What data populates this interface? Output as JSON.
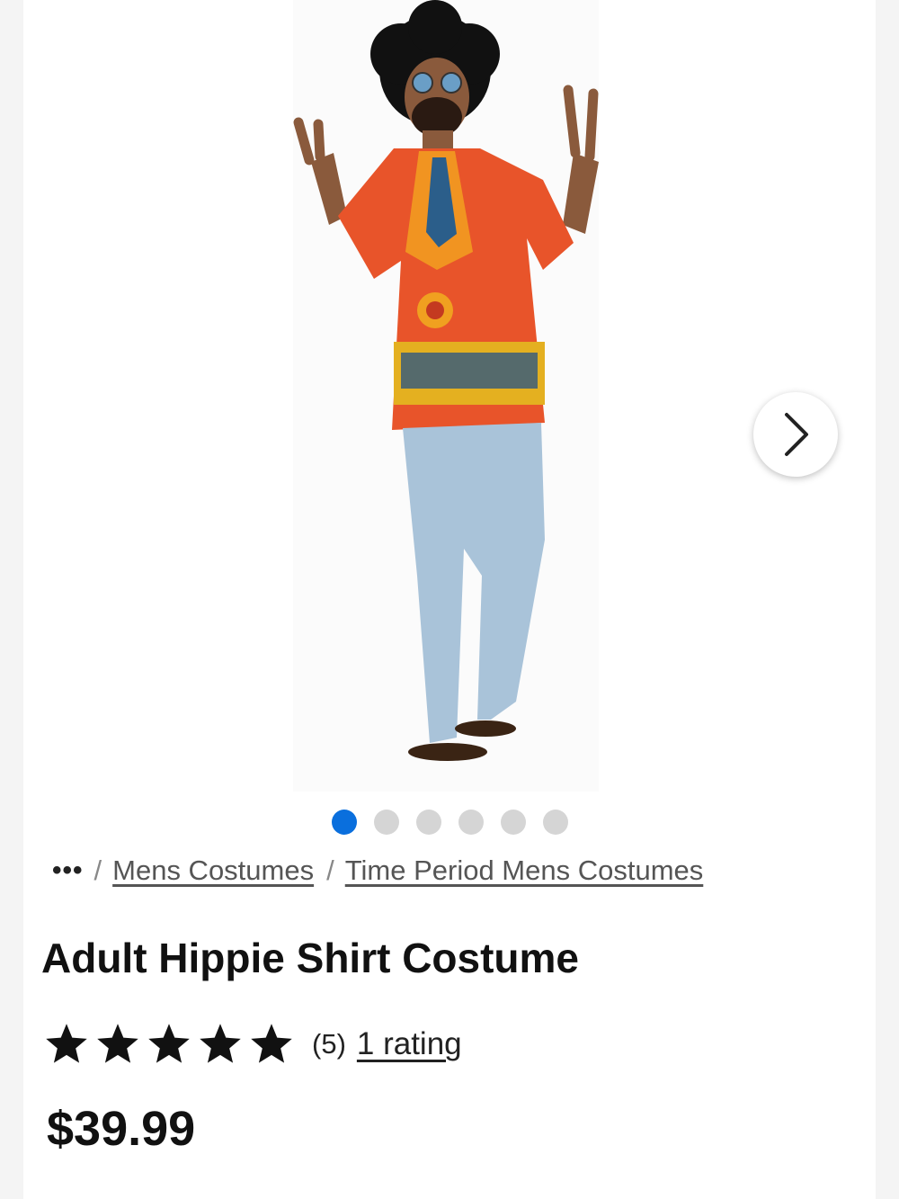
{
  "carousel": {
    "image_alt": "Man wearing orange patterned hippie shirt with afro wig, round sunglasses and jeans, making peace signs",
    "next_icon": "chevron-right-icon",
    "dots_total": 6,
    "active_dot": 1,
    "active_color": "#0a6fdd"
  },
  "breadcrumb": {
    "more": "•••",
    "separator": "/",
    "items": [
      "Mens Costumes",
      "Time Period Mens Costumes"
    ]
  },
  "product": {
    "title": "Adult Hippie Shirt Costume",
    "stars": 5,
    "rating_count": "(5)",
    "rating_link": "1 rating",
    "price": "$39.99"
  }
}
